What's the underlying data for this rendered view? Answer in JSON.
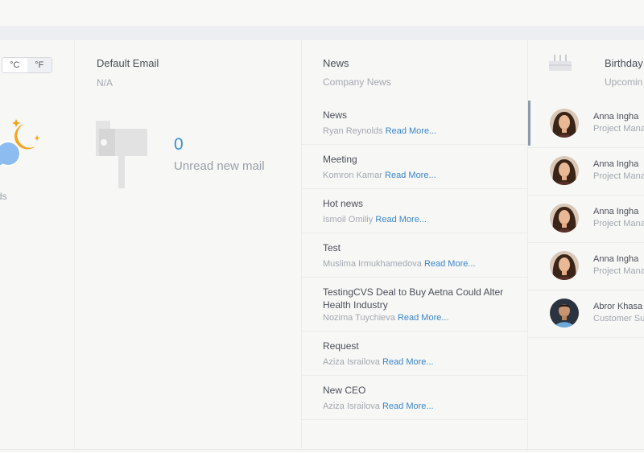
{
  "weather": {
    "unit_c": "°C",
    "unit_f": "°F",
    "active_unit": "F",
    "condition_fragment": "ds"
  },
  "email": {
    "title": "Default Email",
    "address": "N/A",
    "unread_count": "0",
    "unread_label": "Unread new mail"
  },
  "news": {
    "title": "News",
    "subtitle": "Company News",
    "read_more_label": "Read More...",
    "items": [
      {
        "title": "News",
        "author": "Ryan Reynolds"
      },
      {
        "title": "Meeting",
        "author": "Komron Kamar"
      },
      {
        "title": "Hot news",
        "author": "Ismoil Omiliy"
      },
      {
        "title": "Test",
        "author": "Muslima Irmukhamedova"
      },
      {
        "title": "TestingCVS Deal to Buy Aetna Could Alter Health Industry",
        "author": "Nozima Tuychieva"
      },
      {
        "title": "Request",
        "author": "Aziza Israilova"
      },
      {
        "title": "New CEO",
        "author": "Aziza Israilova"
      }
    ]
  },
  "birthdays": {
    "title": "Birthday",
    "subtitle": "Upcomin",
    "items": [
      {
        "name": "Anna Ingha",
        "role": "Project Mana",
        "avatar": "female"
      },
      {
        "name": "Anna Ingha",
        "role": "Project Mana",
        "avatar": "female"
      },
      {
        "name": "Anna Ingha",
        "role": "Project Mana",
        "avatar": "female"
      },
      {
        "name": "Anna Ingha",
        "role": "Project Mana",
        "avatar": "female"
      },
      {
        "name": "Abror Khasa",
        "role": "Customer Su",
        "avatar": "male"
      }
    ]
  },
  "colors": {
    "accent": "#3c8fd5",
    "link": "#3a86cc",
    "moon": "#f5a31c",
    "cloud": "#8cbcf0"
  }
}
